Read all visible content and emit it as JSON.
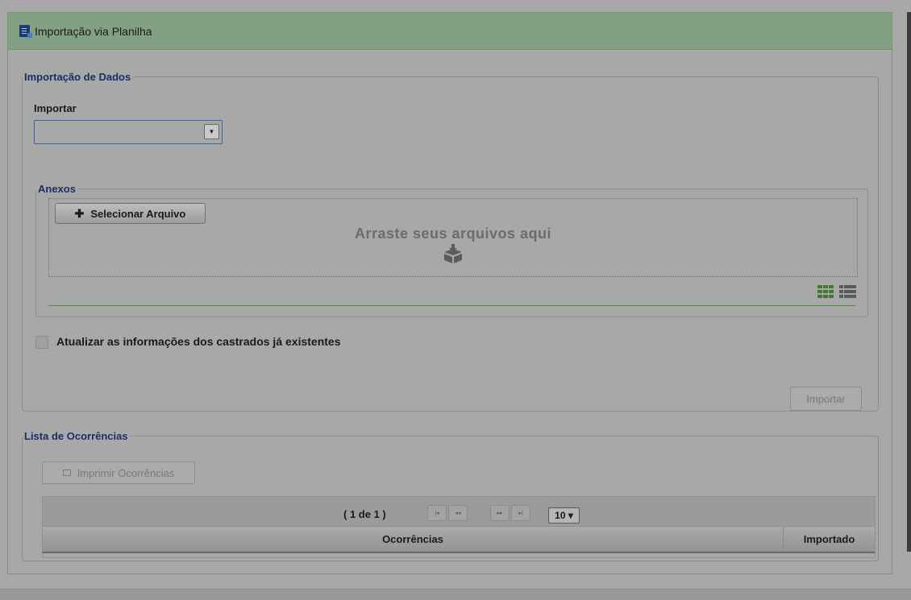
{
  "panel": {
    "title": "Importação via Planilha",
    "icon": "spreadsheet-doc-icon"
  },
  "dados": {
    "legend": "Importação de Dados",
    "importar_label": "Importar",
    "importar_value": "",
    "anexos": {
      "legend": "Anexos",
      "select_file_label": "Selecionar Arquivo",
      "drop_text": "Arraste seus arquivos aqui",
      "drop_icon": "box-download-icon",
      "grid_view_icon": "grid-view-icon",
      "list_view_icon": "list-view-icon"
    },
    "update_checkbox_label": "Atualizar as informações dos castrados já existentes",
    "update_checkbox_checked": false,
    "import_button_label": "Importar"
  },
  "lista": {
    "legend": "Lista de Ocorrências",
    "print_button_label": "Imprimir Ocorrências",
    "paginator": {
      "text": "( 1 de 1 )",
      "rows_per_page": "10 ▾",
      "first": "|◂",
      "prev": "◂◂",
      "next": "▸▸",
      "last": "▸|"
    },
    "columns": [
      "Ocorrências",
      "Importado"
    ],
    "rows": []
  },
  "colors": {
    "header_bg": "#84a083",
    "legend_text": "#1b2f66",
    "accent_green": "#4f8a3f",
    "overlay_bg": "#a8a8a8"
  }
}
